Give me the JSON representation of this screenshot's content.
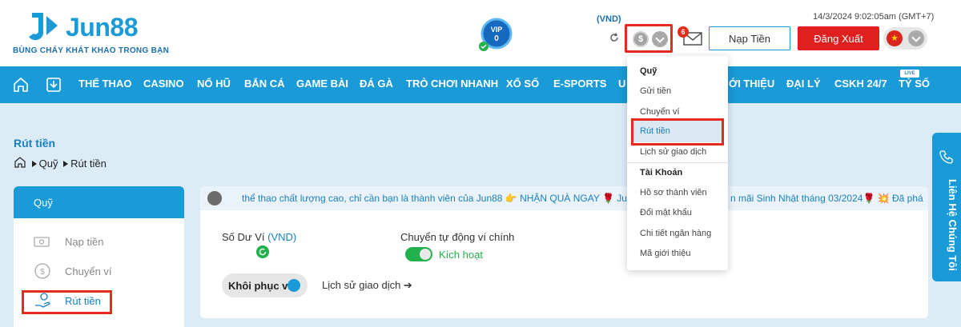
{
  "brand": {
    "name": "Jun88",
    "slogan": "BÙNG CHÁY KHÁT KHAO TRONG BẠN",
    "color": "#1a9ad6"
  },
  "header": {
    "vip_label": "VIP",
    "vip_level": "0",
    "currency": "(VND)",
    "mail_count": "6",
    "datetime": "14/3/2024 9:02:05am (GMT+7)",
    "deposit_label": "Nạp Tiền",
    "logout_label": "Đăng Xuất",
    "coin_symbol": "$"
  },
  "nav": {
    "items": [
      "THỂ THAO",
      "CASINO",
      "NỔ HŨ",
      "BẮN CÁ",
      "GAME BÀI",
      "ĐÁ GÀ",
      "TRÒ CHƠI NHANH",
      "XỔ SỐ",
      "E-SPORTS",
      "U",
      "ỚI THIỆU",
      "ĐẠI LÝ",
      "CSKH 24/7",
      "TỶ SỐ"
    ],
    "live_badge": "LIVE"
  },
  "page": {
    "title": "Rút tiền",
    "breadcrumb": [
      "Quỹ",
      "Rút tiền"
    ]
  },
  "sidebar": {
    "header": "Quỹ",
    "items": [
      {
        "label": "Nạp tiền"
      },
      {
        "label": "Chuyển ví"
      },
      {
        "label": "Rút tiền"
      }
    ]
  },
  "panel": {
    "marquee": "thể thao chất lượng cao, chỉ cần bạn là thành viên của Jun88 👉 NHẬN QUÀ NGAY 🌹 Jun",
    "marquee_tail": "n mãi Sinh Nhật tháng 03/2024🌹 💥 Đã phá",
    "balance_label": "Số Dư Ví",
    "balance_currency": "(VND)",
    "auto_label": "Chuyển tự động ví chính",
    "toggle_label": "Kích hoạt",
    "restore_label": "Khôi phục ví",
    "history_label": "Lịch sử giao dịch ➔"
  },
  "dropdown": {
    "section1": "Quỹ",
    "items1": [
      "Gửi tiền",
      "Chuyển ví",
      "Rút tiền",
      "Lịch sử giao dịch"
    ],
    "section2": "Tài Khoản",
    "items2": [
      "Hồ sơ thành viên",
      "Đổi mật khẩu",
      "Chi tiết ngân hàng",
      "Mã giới thiệu"
    ]
  },
  "contact": {
    "label": "Liên Hệ Chúng Tôi"
  }
}
